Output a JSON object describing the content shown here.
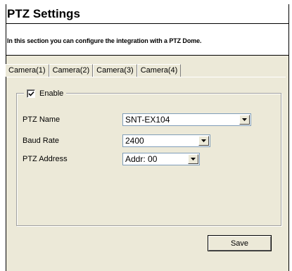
{
  "page": {
    "title": "PTZ Settings",
    "description": "In this section you can configure the integration with a PTZ Dome."
  },
  "tabs": [
    {
      "label": "Camera(1)",
      "active": true
    },
    {
      "label": "Camera(2)",
      "active": false
    },
    {
      "label": "Camera(3)",
      "active": false
    },
    {
      "label": "Camera(4)",
      "active": false
    }
  ],
  "settings": {
    "enable": {
      "label": "Enable",
      "checked": true
    },
    "ptz_name": {
      "label": "PTZ Name",
      "value": "SNT-EX104"
    },
    "baud_rate": {
      "label": "Baud Rate",
      "value": "2400"
    },
    "ptz_address": {
      "label": "PTZ Address",
      "value": "Addr: 00"
    }
  },
  "actions": {
    "save_label": "Save"
  },
  "icons": {
    "checkbox": "check-icon",
    "dropdown": "chevron-down-icon"
  }
}
